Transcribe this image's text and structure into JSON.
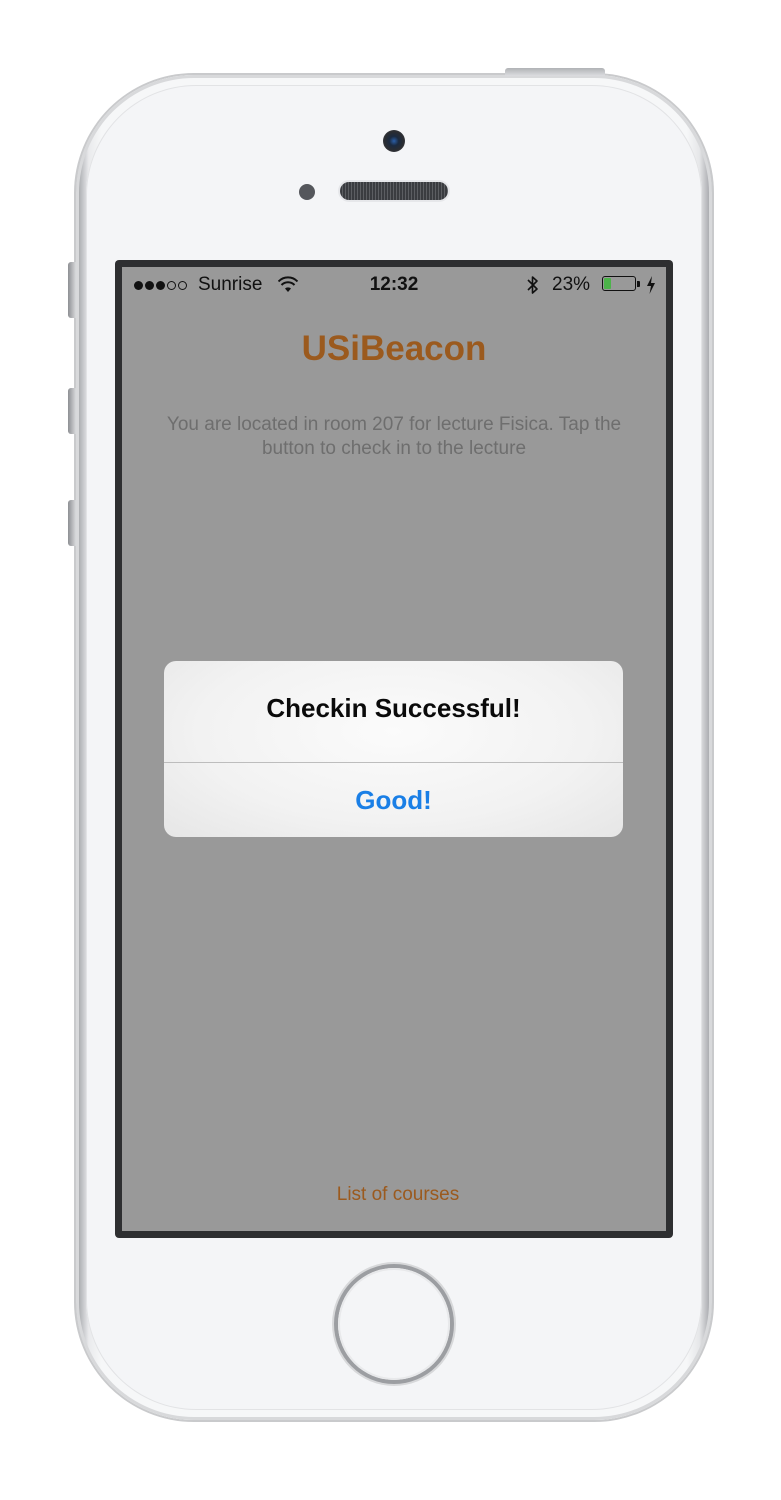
{
  "status_bar": {
    "carrier": "Sunrise",
    "time": "12:32",
    "battery_percent": "23%",
    "battery_level": 0.23,
    "signal_bars_filled": 3,
    "signal_bars_total": 5
  },
  "app": {
    "title": "USiBeacon",
    "message": "You are located in room 207 for lecture Fisica. Tap the button to check in to the lecture",
    "courses_link": "List of courses"
  },
  "alert": {
    "title": "Checkin Successful!",
    "button_label": "Good!"
  },
  "colors": {
    "accent": "#9b5a1e",
    "alert_button": "#1a7fe6",
    "overlay": "#999999",
    "battery": "#4cb34a"
  }
}
